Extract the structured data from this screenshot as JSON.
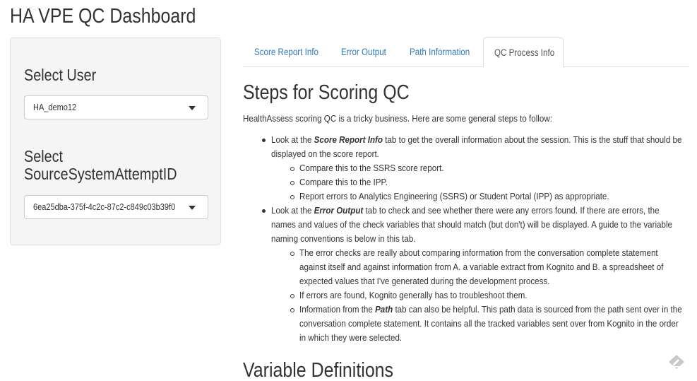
{
  "app": {
    "title": "HA VPE QC Dashboard"
  },
  "sidebar": {
    "user_label": "Select User",
    "user_value": "HA_demo12",
    "attempt_label_line1": "Select",
    "attempt_label_line2": "SourceSystemAttemptID",
    "attempt_value": "6ea25dba-375f-4c2c-87c2-c849c03b39f0"
  },
  "tabs": [
    {
      "label": "Score Report Info",
      "active": false
    },
    {
      "label": "Error Output",
      "active": false
    },
    {
      "label": "Path Information",
      "active": false
    },
    {
      "label": "QC Process Info",
      "active": true
    }
  ],
  "content": {
    "heading": "Steps for Scoring QC",
    "intro": "HealthAssess scoring QC is a tricky business. Here are some general steps to follow:",
    "b1": {
      "pre": "Look at the ",
      "emph": "Score Report Info",
      "post": " tab to get the overall information about the session. This is the stuff that should be",
      "line2": "displayed on the score report.",
      "subs": [
        "Compare this to the SSRS score report.",
        "Compare this to the IPP.",
        "Report errors to Analytics Engineering (SSRS) or Student Portal (IPP) as appropriate."
      ]
    },
    "b2": {
      "pre": "Look at the ",
      "emph": "Error Output",
      "post": " tab to check and see whether there were any errors found. If there are errors, the",
      "line2": "names and values of the check variables that should match (but don't) will be displayed. A guide to the variable",
      "line3": "naming conventions is below in this tab.",
      "sub1": {
        "l1": "The error checks are really about comparing information from the conversation complete statement",
        "l2": "against itself and against information from A. a variable extract from Kognito and B. a spreadsheet of",
        "l3": "expected values that I've generated during the development process."
      },
      "sub2": "If errors are found, Kognito generally has to troubleshoot them.",
      "sub3": {
        "pre": "Information from the ",
        "emph": "Path",
        "post": " tab can also be helpful. This path data is sourced from the path sent over in the",
        "l2": "conversation complete statement. It contains all the tracked variables sent over from Kognito in the order",
        "l3": "in which they were selected."
      }
    },
    "heading2": "Variable Definitions"
  },
  "icons": {
    "edit": "edit-icon"
  }
}
